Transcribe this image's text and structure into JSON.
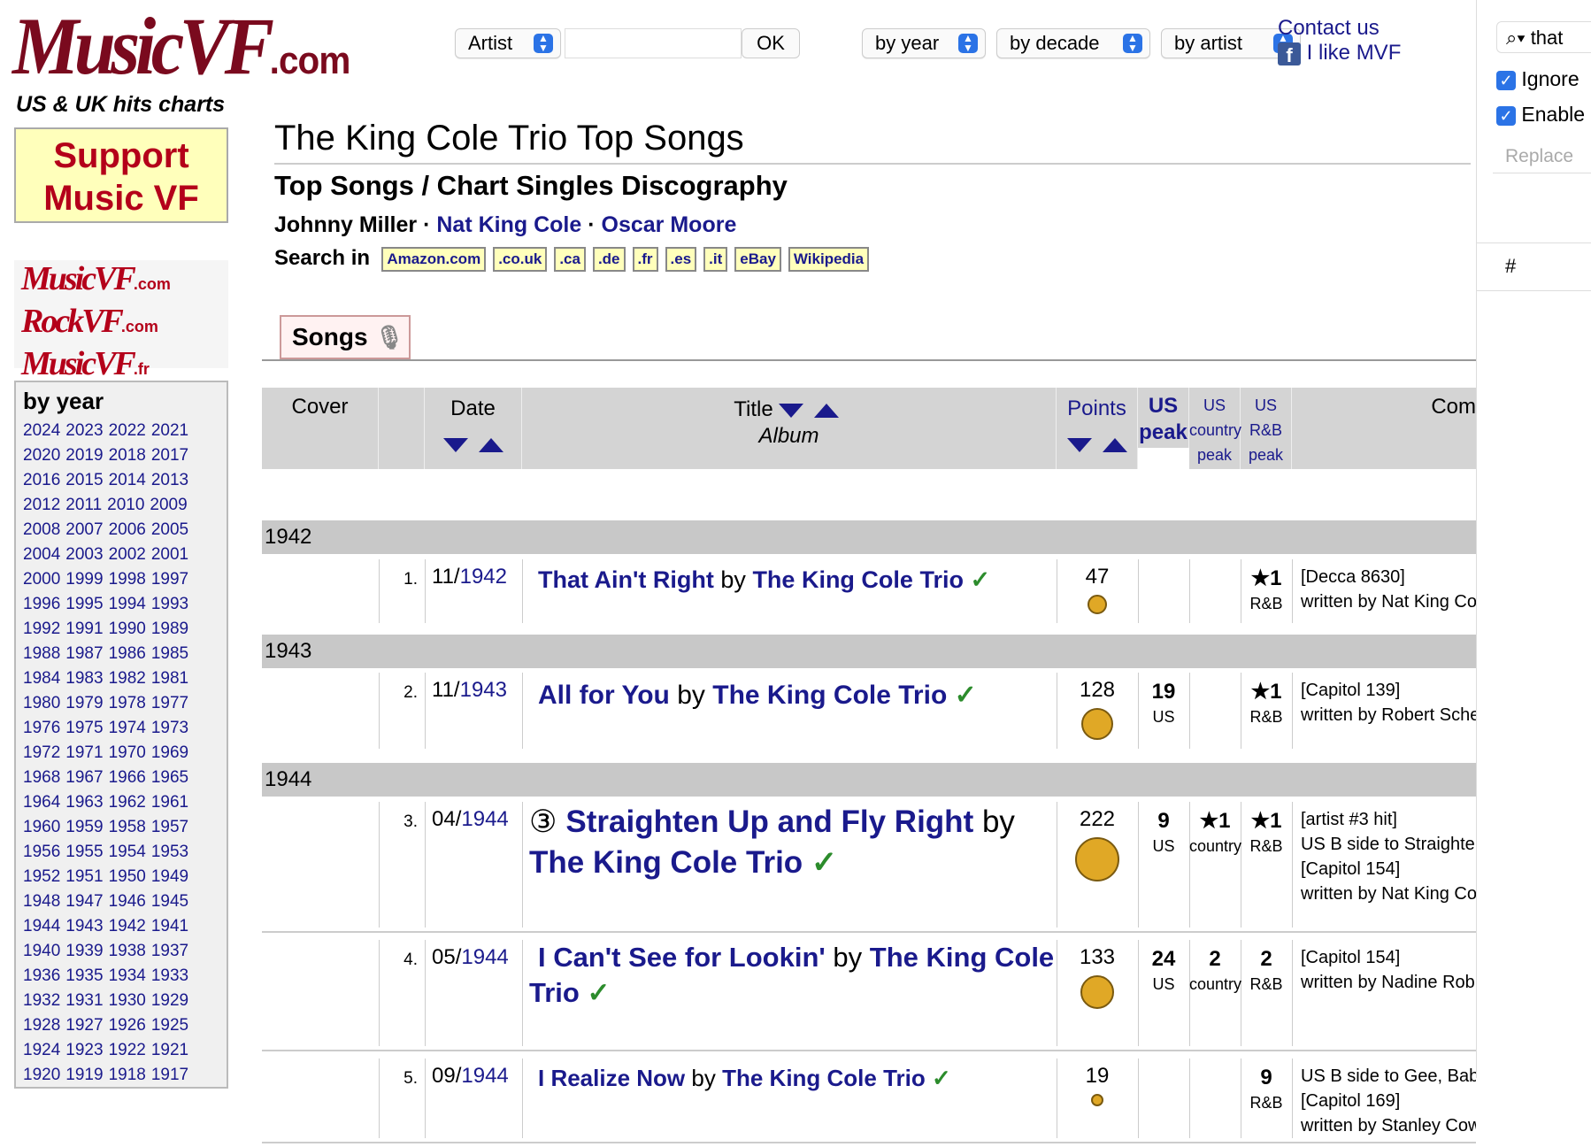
{
  "site": {
    "logo_main": "MusicVF",
    "logo_com": ".com",
    "tagline": "US & UK hits charts",
    "support": "Support Music VF",
    "minilogos": [
      {
        "name": "MusicVF",
        "tld": ".com"
      },
      {
        "name": "RockVF",
        "tld": ".com"
      },
      {
        "name": "MusicVF",
        "tld": ".fr"
      }
    ]
  },
  "topform": {
    "artist_select": "Artist",
    "search_value": "",
    "ok": "OK",
    "by_year": "by year",
    "by_decade": "by decade",
    "by_artist": "by artist",
    "contact": "Contact us",
    "like": "I like MVF"
  },
  "right_panel": {
    "find_text": "that",
    "opt1": "Ignore",
    "opt2": "Enable",
    "replace": "Replace",
    "hash": "#"
  },
  "sidebar": {
    "heading": "by year",
    "years": [
      [
        "2024",
        "2023",
        "2022",
        "2021"
      ],
      [
        "2020",
        "2019",
        "2018",
        "2017"
      ],
      [
        "2016",
        "2015",
        "2014",
        "2013"
      ],
      [
        "2012",
        "2011",
        "2010",
        "2009"
      ],
      [
        "2008",
        "2007",
        "2006",
        "2005"
      ],
      [
        "2004",
        "2003",
        "2002",
        "2001"
      ],
      [
        "2000",
        "1999",
        "1998",
        "1997"
      ],
      [
        "1996",
        "1995",
        "1994",
        "1993"
      ],
      [
        "1992",
        "1991",
        "1990",
        "1989"
      ],
      [
        "1988",
        "1987",
        "1986",
        "1985"
      ],
      [
        "1984",
        "1983",
        "1982",
        "1981"
      ],
      [
        "1980",
        "1979",
        "1978",
        "1977"
      ],
      [
        "1976",
        "1975",
        "1974",
        "1973"
      ],
      [
        "1972",
        "1971",
        "1970",
        "1969"
      ],
      [
        "1968",
        "1967",
        "1966",
        "1965"
      ],
      [
        "1964",
        "1963",
        "1962",
        "1961"
      ],
      [
        "1960",
        "1959",
        "1958",
        "1957"
      ],
      [
        "1956",
        "1955",
        "1954",
        "1953"
      ],
      [
        "1952",
        "1951",
        "1950",
        "1949"
      ],
      [
        "1948",
        "1947",
        "1946",
        "1945"
      ],
      [
        "1944",
        "1943",
        "1942",
        "1941"
      ],
      [
        "1940",
        "1939",
        "1938",
        "1937"
      ],
      [
        "1936",
        "1935",
        "1934",
        "1933"
      ],
      [
        "1932",
        "1931",
        "1930",
        "1929"
      ],
      [
        "1928",
        "1927",
        "1926",
        "1925"
      ],
      [
        "1924",
        "1923",
        "1922",
        "1921"
      ],
      [
        "1920",
        "1919",
        "1918",
        "1917"
      ]
    ]
  },
  "page": {
    "title": "The King Cole Trio Top Songs",
    "subtitle": "Top Songs / Chart Singles Discography",
    "member1": "Johnny Miller",
    "member2": "Nat King Cole",
    "member3": "Oscar Moore",
    "sep": "·",
    "search_label": "Search in",
    "shops": [
      "Amazon.com",
      ".co.uk",
      ".ca",
      ".de",
      ".fr",
      ".es",
      ".it",
      "eBay",
      "Wikipedia"
    ],
    "tab": "Songs"
  },
  "table": {
    "headers": {
      "cover": "Cover",
      "date": "Date",
      "title": "Title",
      "album": "Album",
      "points": "Points",
      "us": "US",
      "us_peak": "peak",
      "country_us": "US",
      "country": "country",
      "country_peak": "peak",
      "rnb_us": "US",
      "rnb": "R&B",
      "rnb_peak": "peak",
      "comment": "Com"
    },
    "years": [
      "1942",
      "1943",
      "1944"
    ],
    "rows": [
      {
        "rank": "1.",
        "month": "11/",
        "year": "1942",
        "circled": "",
        "title": "That Ain't Right",
        "by": "by",
        "artist": "The King Cole Trio",
        "check": "✓",
        "points": "47",
        "us": "",
        "us_lbl": "",
        "country": "",
        "country_lbl": "",
        "rnb": "★1",
        "rnb_lbl": "R&B",
        "comments": [
          "[Decca 8630]",
          "written by Nat King Cole"
        ]
      },
      {
        "rank": "2.",
        "month": "11/",
        "year": "1943",
        "circled": "",
        "title": "All for You",
        "by": "by",
        "artist": "The King Cole Trio",
        "check": "✓",
        "points": "128",
        "us": "19",
        "us_lbl": "US",
        "country": "",
        "country_lbl": "",
        "rnb": "★1",
        "rnb_lbl": "R&B",
        "comments": [
          "[Capitol 139]",
          "written by Robert Scherman"
        ]
      },
      {
        "rank": "3.",
        "month": "04/",
        "year": "1944",
        "circled": "③",
        "title": "Straighten Up and Fly Right",
        "by": "by",
        "artist": "The King Cole Trio",
        "check": "✓",
        "points": "222",
        "us": "9",
        "us_lbl": "US",
        "country": "★1",
        "country_lbl": "country",
        "rnb": "★1",
        "rnb_lbl": "R&B",
        "comments": [
          "[artist #3 hit]",
          "US B side to Straighten Up",
          "[Capitol 154]",
          "written by Nat King Cole & I"
        ]
      },
      {
        "rank": "4.",
        "month": "05/",
        "year": "1944",
        "circled": "",
        "title": "I Can't See for Lookin'",
        "by": "by",
        "artist": "The King Cole Trio",
        "check": "✓",
        "points": "133",
        "us": "24",
        "us_lbl": "US",
        "country": "2",
        "country_lbl": "country",
        "rnb": "2",
        "rnb_lbl": "R&B",
        "comments": [
          "[Capitol 154]",
          "written by Nadine Robinson"
        ]
      },
      {
        "rank": "5.",
        "month": "09/",
        "year": "1944",
        "circled": "",
        "title": "I Realize Now",
        "by": "by",
        "artist": "The King Cole Trio",
        "check": "✓",
        "points": "19",
        "us": "",
        "us_lbl": "",
        "country": "",
        "country_lbl": "",
        "rnb": "9",
        "rnb_lbl": "R&B",
        "comments": [
          "US B side to Gee, Baby, Ain",
          "[Capitol 169]",
          "written by Stanley Cowen &"
        ]
      }
    ]
  },
  "colors": {
    "brand": "#7a0a1e",
    "link": "#1a1a8c",
    "support_bg": "#ffffbb",
    "point_dot": "#e0a826",
    "check": "#2c8c2c"
  }
}
